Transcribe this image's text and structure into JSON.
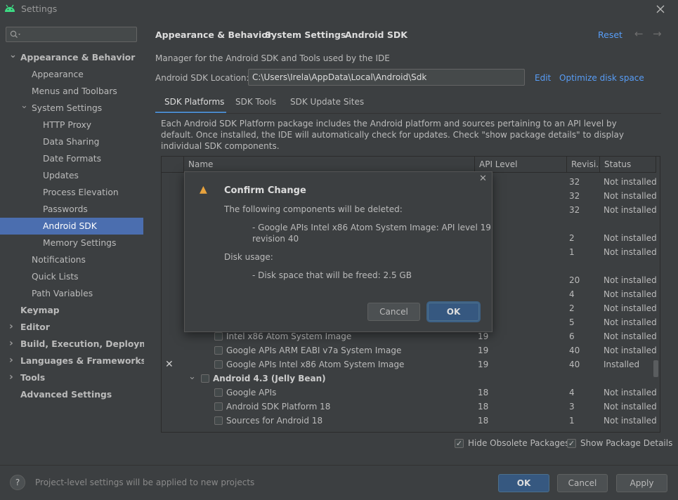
{
  "window": {
    "title": "Settings",
    "app_icon": "android-icon",
    "close_icon": "close-icon"
  },
  "sidebar": {
    "search_placeholder": "",
    "items": [
      {
        "label": "Appearance & Behavior",
        "level": 0,
        "bold": true,
        "expanded": true
      },
      {
        "label": "Appearance",
        "level": 1
      },
      {
        "label": "Menus and Toolbars",
        "level": 1
      },
      {
        "label": "System Settings",
        "level": 1,
        "expanded": true
      },
      {
        "label": "HTTP Proxy",
        "level": 2
      },
      {
        "label": "Data Sharing",
        "level": 2
      },
      {
        "label": "Date Formats",
        "level": 2
      },
      {
        "label": "Updates",
        "level": 2
      },
      {
        "label": "Process Elevation",
        "level": 2
      },
      {
        "label": "Passwords",
        "level": 2
      },
      {
        "label": "Android SDK",
        "level": 2,
        "selected": true
      },
      {
        "label": "Memory Settings",
        "level": 2
      },
      {
        "label": "Notifications",
        "level": 1
      },
      {
        "label": "Quick Lists",
        "level": 1
      },
      {
        "label": "Path Variables",
        "level": 1
      },
      {
        "label": "Keymap",
        "level": 0,
        "bold": true
      },
      {
        "label": "Editor",
        "level": 0,
        "bold": true,
        "collapsed": true
      },
      {
        "label": "Build, Execution, Deployment",
        "level": 0,
        "bold": true,
        "collapsed": true
      },
      {
        "label": "Languages & Frameworks",
        "level": 0,
        "bold": true,
        "collapsed": true
      },
      {
        "label": "Tools",
        "level": 0,
        "bold": true,
        "collapsed": true
      },
      {
        "label": "Advanced Settings",
        "level": 0,
        "bold": true
      }
    ]
  },
  "breadcrumb": {
    "part1": "Appearance & Behavior",
    "part2": "System Settings",
    "part3": "Android SDK",
    "sep": "›"
  },
  "header": {
    "reset": "Reset",
    "back": "←",
    "forward": "→"
  },
  "main": {
    "description": "Manager for the Android SDK and Tools used by the IDE",
    "sdk_location_label": "Android SDK Location:",
    "sdk_location_value": "C:\\Users\\Irela\\AppData\\Local\\Android\\Sdk",
    "edit": "Edit",
    "optimize": "Optimize disk space",
    "tabs": [
      {
        "label": "SDK Platforms"
      },
      {
        "label": "SDK Tools"
      },
      {
        "label": "SDK Update Sites"
      }
    ],
    "info_line1": "Each Android SDK Platform package includes the Android platform and sources pertaining to an API level by",
    "info_line2": "default. Once installed, the IDE will automatically check for updates. Check \"show package details\" to display",
    "info_line3": "individual SDK components."
  },
  "table": {
    "headers": {
      "name": "Name",
      "api": "API Level",
      "rev": "Revisi...",
      "status": "Status"
    },
    "top_rows": [
      {
        "rev": "32",
        "status": "Not installed"
      },
      {
        "rev": "32",
        "status": "Not installed"
      },
      {
        "rev": "32",
        "status": "Not installed"
      },
      {
        "rev": "2",
        "status": "Not installed"
      },
      {
        "rev": "1",
        "status": "Not installed"
      },
      {
        "rev": "20",
        "status": "Not installed"
      },
      {
        "rev": "4",
        "status": "Not installed"
      },
      {
        "rev": "2",
        "status": "Not installed"
      },
      {
        "rev": "5",
        "status": "Not installed"
      }
    ],
    "rows": [
      {
        "name": "Intel x86 Atom System Image",
        "api": "19",
        "rev": "6",
        "status": "Not installed"
      },
      {
        "name": "Google APIs ARM EABI v7a System Image",
        "api": "19",
        "rev": "40",
        "status": "Not installed"
      },
      {
        "name": "Google APIs Intel x86 Atom System Image",
        "api": "19",
        "rev": "40",
        "status": "Installed",
        "marked": "✕"
      },
      {
        "name": "Android 4.3 (Jelly Bean)",
        "group": true
      },
      {
        "name": "Google APIs",
        "api": "18",
        "rev": "4",
        "status": "Not installed"
      },
      {
        "name": "Android SDK Platform 18",
        "api": "18",
        "rev": "3",
        "status": "Not installed"
      },
      {
        "name": "Sources for Android 18",
        "api": "18",
        "rev": "1",
        "status": "Not installed"
      }
    ]
  },
  "options": {
    "hide_obsolete": "Hide Obsolete Packages",
    "show_details": "Show Package Details",
    "check": "✓"
  },
  "dialog": {
    "title": "Confirm Change",
    "intro": "The following components will be deleted:",
    "component_line1": "- Google APIs Intel x86 Atom System Image: API level 19",
    "component_line2": "revision 40",
    "disk_label": "Disk usage:",
    "disk_line": "- Disk space that will be freed: 2.5 GB",
    "cancel": "Cancel",
    "ok": "OK",
    "close": "✕",
    "warning": "▲"
  },
  "footer": {
    "help": "?",
    "note": "Project-level settings will be applied to new projects",
    "ok": "OK",
    "cancel": "Cancel",
    "apply": "Apply"
  }
}
